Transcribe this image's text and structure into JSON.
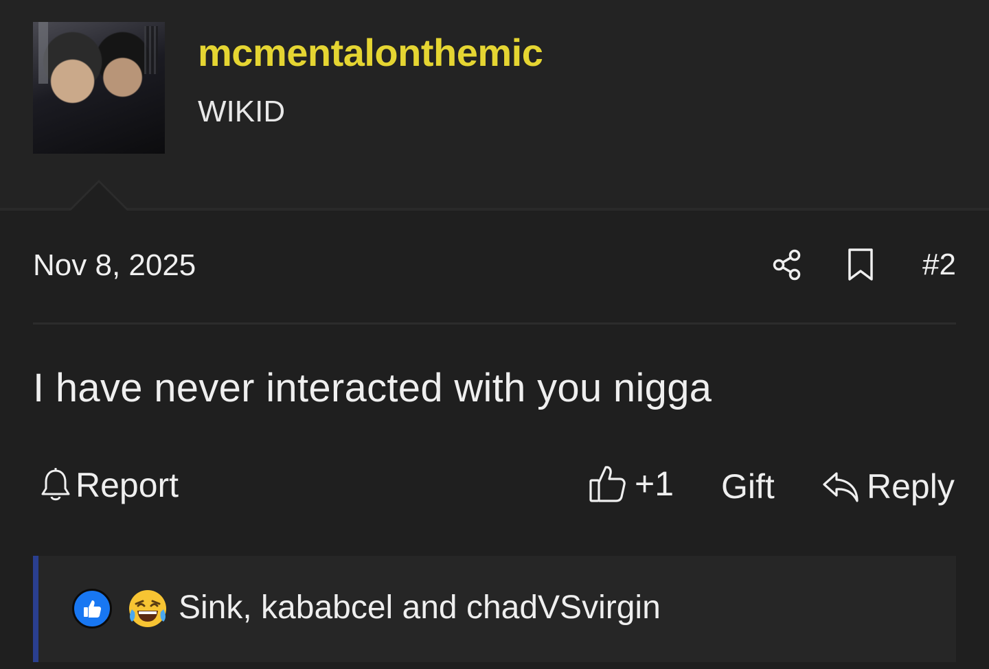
{
  "user": {
    "name": "mcmentalonthemic",
    "title": "WIKID"
  },
  "post": {
    "date": "Nov 8, 2025",
    "number": "#2",
    "message": "I have never interacted with you nigga"
  },
  "actions": {
    "report_label": "Report",
    "like_count": "+1",
    "gift_label": "Gift",
    "reply_label": "Reply"
  },
  "reactions": {
    "summary": "Sink, kababcel and chadVSvirgin",
    "icons": [
      "like-reaction-icon",
      "laugh-reaction-icon"
    ]
  },
  "colors": {
    "username": "#e5d532",
    "background": "#232323",
    "post_background": "#1f1f1f",
    "reaction_accent": "#2a3f8f",
    "like_blue": "#1877f2"
  }
}
